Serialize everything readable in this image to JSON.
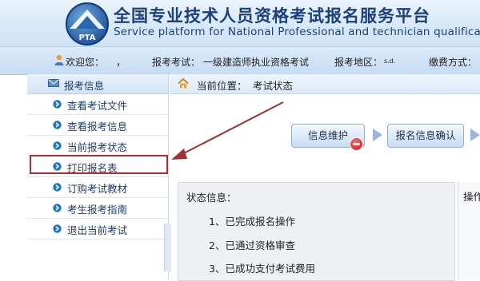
{
  "header": {
    "title": "全国专业技术人员资格考试报名服务平台",
    "subtitle": "Service platform for National Professional and technician qualification",
    "logo_text": "PTA"
  },
  "infobar": {
    "welcome": "欢迎您：",
    "welcome_name": "，",
    "exam_label": "报考考试：",
    "exam_value": "一级建造师执业资格考试",
    "region_label": "报考地区：",
    "region_value": "s.d.",
    "pay_label": "缴费方式："
  },
  "sidebar": {
    "heading": "报考信息",
    "items": [
      {
        "label": "查看考试文件"
      },
      {
        "label": "查看报考信息"
      },
      {
        "label": "当前报考状态"
      },
      {
        "label": "打印报名表"
      },
      {
        "label": "订购考试教材"
      },
      {
        "label": "考生报考指南"
      },
      {
        "label": "退出当前考试"
      }
    ]
  },
  "breadcrumb": {
    "label": "当前位置：",
    "value": "考试状态"
  },
  "steps": [
    {
      "label": "信息维护"
    },
    {
      "label": "报名信息确认"
    }
  ],
  "status": {
    "title": "状态信息：",
    "lines": [
      "1、已完成报名操作",
      "2、已通过资格审查",
      "3、已成功支付考试费用"
    ]
  },
  "operation": {
    "label": "操作"
  },
  "colors": {
    "brand": "#1d3f7c",
    "highlight": "#b52c2c",
    "arrow": "#a33030",
    "bullet": "#1a74c9"
  }
}
